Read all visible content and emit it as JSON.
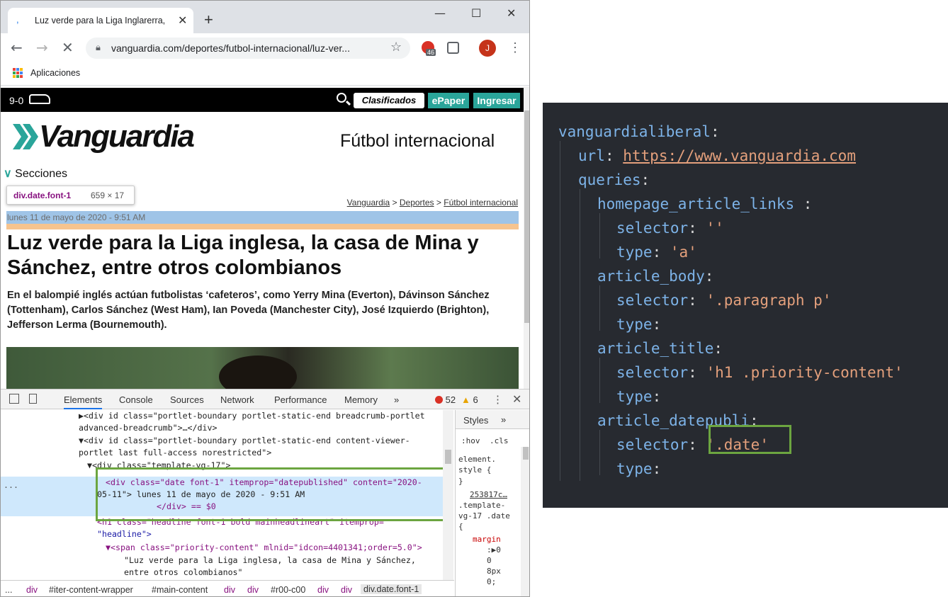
{
  "browser": {
    "tab_title": "Luz verde para la Liga Inglarerra,",
    "tab_close": "✕",
    "new_tab": "+",
    "win_min": "—",
    "win_max": "☐",
    "win_close": "✕",
    "back": "←",
    "forward": "→",
    "reload": "✕",
    "url": "vanguardia.com/deportes/futbol-internacional/luz-ver...",
    "badge_count": "46",
    "avatar_letter": "J",
    "bookmark_apps": "Aplicaciones"
  },
  "site": {
    "score": "9-0",
    "clasificados": "Clasificados",
    "epaper": "ePaper",
    "ingresar": "Ingresar",
    "logo_text": "Vanguardia",
    "section_title": "Fútbol internacional",
    "secciones_chevron": "∨",
    "secciones": "Secciones",
    "tooltip_selector": "div.date.font-1",
    "tooltip_dims": "659 × 17",
    "breadcrumb": [
      "Vanguardia",
      "Deportes",
      "Fútbol internacional"
    ],
    "breadcrumb_sep": ">",
    "date": "lunes 11 de mayo de 2020 - 9:51 AM",
    "headline": "Luz verde para la Liga inglesa, la casa de Mina y Sánchez, entre otros colombianos",
    "lead": "En el balompié inglés actúan futbolistas ‘cafeteros’, como Yerry Mina (Everton), Dávinson Sánchez (Tottenham), Carlos Sánchez (West Ham), Ian Poveda (Manchester City), José Izquierdo (Brighton), Jefferson Lerma (Bournemouth).",
    "accent": "#2aa59a"
  },
  "devtools": {
    "tabs": [
      "Elements",
      "Console",
      "Sources",
      "Network",
      "Performance",
      "Memory"
    ],
    "more_tabs": "»",
    "errors": "52",
    "warnings": "6",
    "warn_icon": "▲",
    "kebab": "⋮",
    "close": "✕",
    "dots": "...",
    "lines": [
      {
        "text": "▶<div id class=\"portlet-boundary portlet-static-end breadcrumb-portlet"
      },
      {
        "text": "advanced-breadcrumb\">…</div>"
      },
      {
        "text": "▼<div id class=\"portlet-boundary portlet-static-end content-viewer-"
      },
      {
        "text": "portlet last full-access norestricted\">"
      },
      {
        "text": "▼<div class=\"template-vg-17\">"
      },
      {
        "text": "<div class=\"date font-1\" itemprop=\"datepublished\" content=\"2020-"
      },
      {
        "text": "05-11\"> lunes 11 de mayo de 2020 - 9:51 AM"
      },
      {
        "text": "</div> == $0"
      },
      {
        "text": "<h1 class=\"headline font-1 bold mainheadlineart\" itemprop="
      },
      {
        "text": "\"headline\">"
      },
      {
        "text": "▼<span class=\"priority-content\" mlnid=\"idcon=4401341;order=5.0\">"
      },
      {
        "text": "\"Luz verde para la Liga inglesa, la casa de Mina y Sánchez,"
      },
      {
        "text": "entre otros colombianos\""
      }
    ],
    "styles_tab": "Styles",
    "styles_more": "»",
    "filter_hov": ":hov",
    "filter_cls": ".cls",
    "styles_lines": [
      "element.",
      "style {",
      "}",
      "253817c…",
      ".template-",
      "vg-17 .date",
      "{",
      "margin",
      ":▶0",
      "0",
      "8px",
      "0;"
    ],
    "crumbs": [
      "div",
      "#iter-content-wrapper",
      "#main-content",
      "div",
      "div",
      "#r00-c00",
      "div",
      "div",
      "div.date.font-1"
    ],
    "crumbs_ellipsis": "..."
  },
  "editor": {
    "root_key": "vanguardialiberal",
    "url_key": "url",
    "url_value": "https://www.vanguardia.com",
    "queries_key": "queries",
    "items": [
      {
        "key": "homepage_article_links",
        "selector": "''",
        "type": "'a'"
      },
      {
        "key": "article_body",
        "selector": "'.paragraph p'",
        "type": ""
      },
      {
        "key": "article_title",
        "selector": "'h1 .priority-content'",
        "type": ""
      },
      {
        "key": "article_datepubli",
        "selector": "'.date'",
        "type": ""
      }
    ],
    "selector_key": "selector",
    "type_key": "type",
    "colon": ":",
    "spaced_colon": " :"
  }
}
